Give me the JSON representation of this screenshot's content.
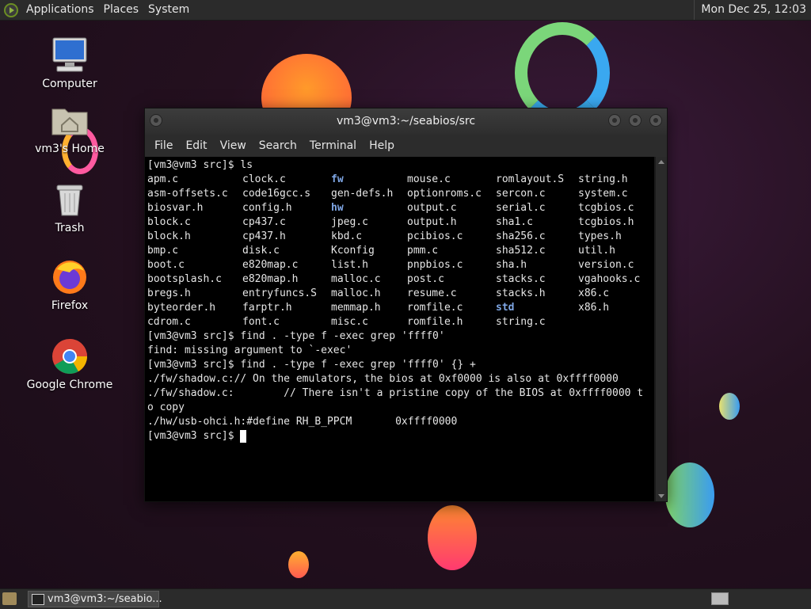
{
  "top_panel": {
    "menus": [
      "Applications",
      "Places",
      "System"
    ],
    "clock": "Mon Dec 25, 12:03"
  },
  "desktop_icons": [
    {
      "label": "Computer",
      "icon": "computer-icon"
    },
    {
      "label": "vm3's Home",
      "icon": "home-folder-icon"
    },
    {
      "label": "Trash",
      "icon": "trash-icon"
    },
    {
      "label": "Firefox",
      "icon": "firefox-icon"
    },
    {
      "label": "Google Chrome",
      "icon": "chrome-icon"
    }
  ],
  "window": {
    "title": "vm3@vm3:~/seabios/src",
    "menu": [
      "File",
      "Edit",
      "View",
      "Search",
      "Terminal",
      "Help"
    ]
  },
  "terminal": {
    "prompt_ls": "[vm3@vm3 src]$ ls",
    "ls_rows": [
      [
        "apm.c",
        "clock.c",
        "fw",
        "mouse.c",
        "romlayout.S",
        "string.h"
      ],
      [
        "asm-offsets.c",
        "code16gcc.s",
        "gen-defs.h",
        "optionroms.c",
        "sercon.c",
        "system.c"
      ],
      [
        "biosvar.h",
        "config.h",
        "hw",
        "output.c",
        "serial.c",
        "tcgbios.c"
      ],
      [
        "block.c",
        "cp437.c",
        "jpeg.c",
        "output.h",
        "sha1.c",
        "tcgbios.h"
      ],
      [
        "block.h",
        "cp437.h",
        "kbd.c",
        "pcibios.c",
        "sha256.c",
        "types.h"
      ],
      [
        "bmp.c",
        "disk.c",
        "Kconfig",
        "pmm.c",
        "sha512.c",
        "util.h"
      ],
      [
        "boot.c",
        "e820map.c",
        "list.h",
        "pnpbios.c",
        "sha.h",
        "version.c"
      ],
      [
        "bootsplash.c",
        "e820map.h",
        "malloc.c",
        "post.c",
        "stacks.c",
        "vgahooks.c"
      ],
      [
        "bregs.h",
        "entryfuncs.S",
        "malloc.h",
        "resume.c",
        "stacks.h",
        "x86.c"
      ],
      [
        "byteorder.h",
        "farptr.h",
        "memmap.h",
        "romfile.c",
        "std",
        "x86.h"
      ],
      [
        "cdrom.c",
        "font.c",
        "misc.c",
        "romfile.h",
        "string.c",
        ""
      ]
    ],
    "dirs": [
      "fw",
      "hw",
      "std"
    ],
    "lines_after": [
      "[vm3@vm3 src]$ find . -type f -exec grep 'ffff0'",
      "find: missing argument to `-exec'",
      "[vm3@vm3 src]$ find . -type f -exec grep 'ffff0' {} +",
      "./fw/shadow.c:// On the emulators, the bios at 0xf0000 is also at 0xffff0000",
      "./fw/shadow.c:        // There isn't a pristine copy of the BIOS at 0xffff0000 t",
      "o copy",
      "./hw/usb-ohci.h:#define RH_B_PPCM       0xffff0000"
    ],
    "final_prompt": "[vm3@vm3 src]$ "
  },
  "taskbar": {
    "task_label": "vm3@vm3:~/seabio..."
  }
}
